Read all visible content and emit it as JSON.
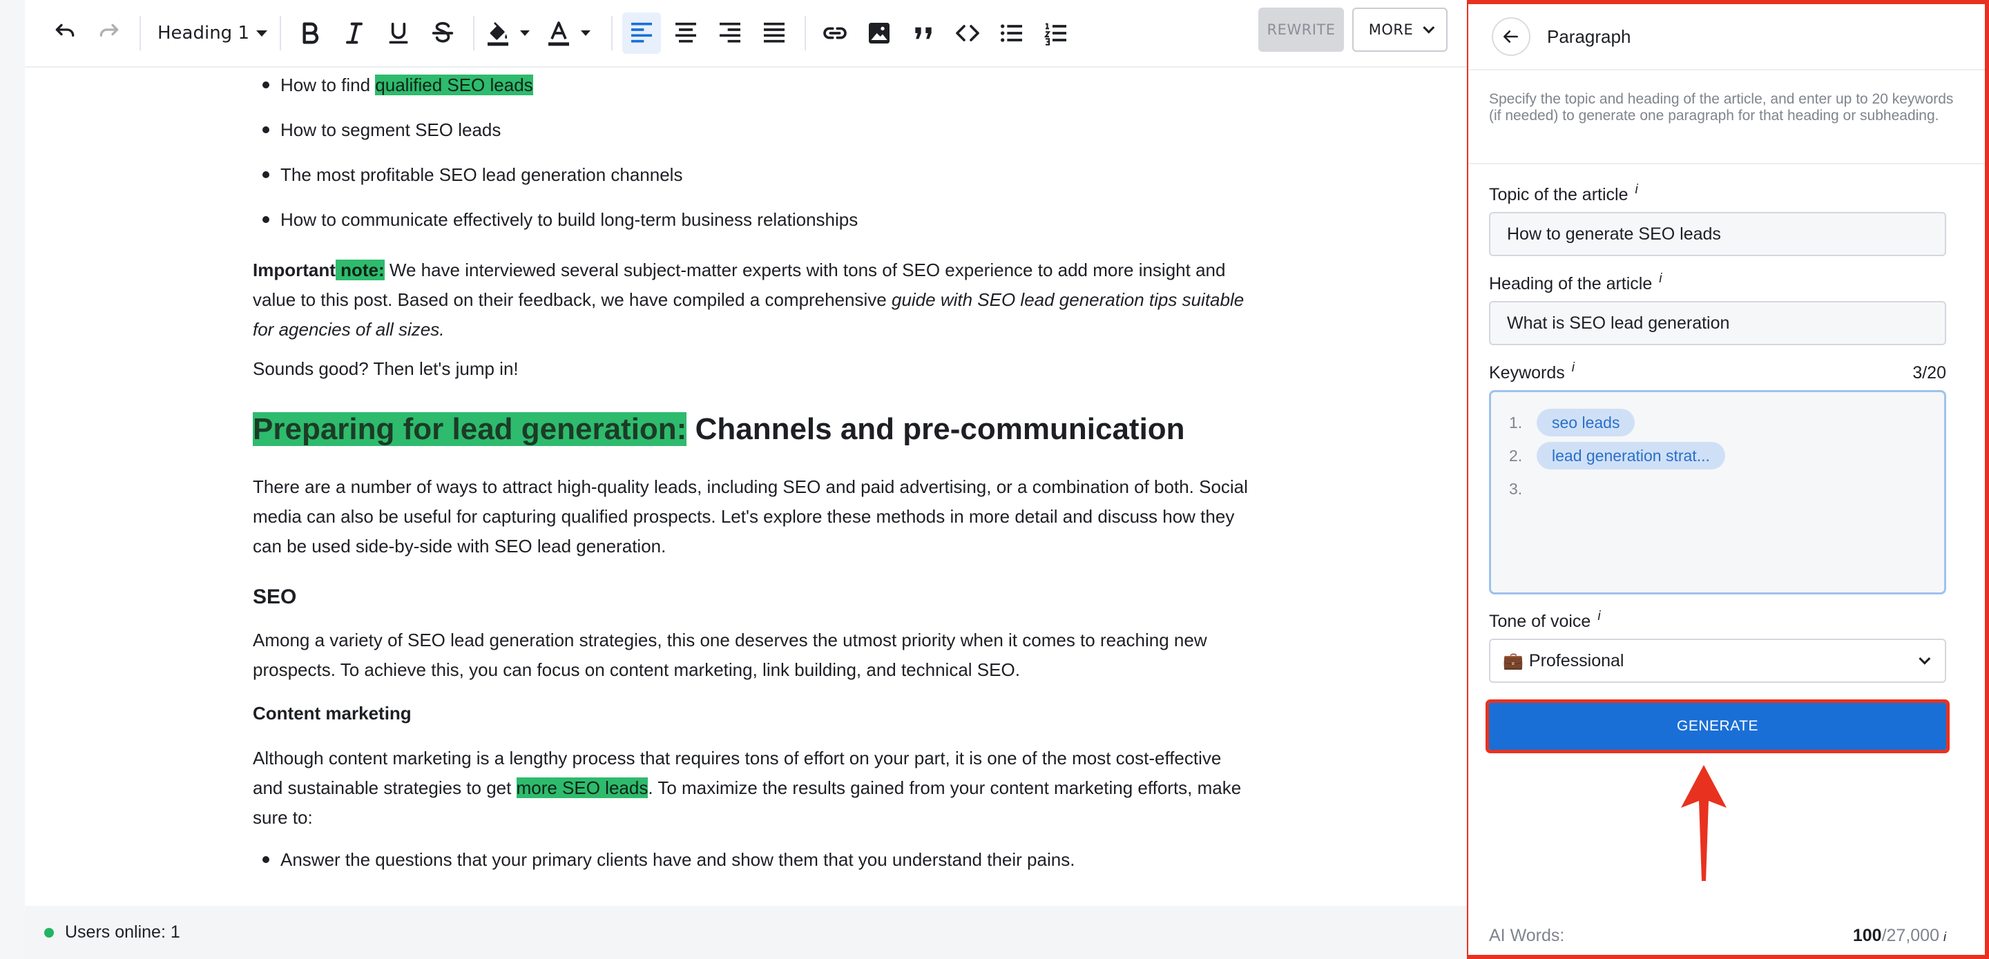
{
  "toolbar": {
    "heading_select": "Heading 1",
    "rewrite_label": "REWRITE",
    "more_label": "MORE"
  },
  "content": {
    "bullets_top": [
      {
        "pre": "How to find ",
        "hl": "qualified SEO leads",
        "post": ""
      },
      {
        "pre": "How to segment SEO leads",
        "hl": "",
        "post": ""
      },
      {
        "pre": "The most profitable SEO lead generation channels",
        "hl": "",
        "post": ""
      },
      {
        "pre": "How to communicate effectively to build long-term business relationships",
        "hl": "",
        "post": ""
      }
    ],
    "note": {
      "bold": "Important",
      "bold_hl": " note:",
      "text1": " We have interviewed several subject-matter experts with tons of SEO experience to add more insight and value to this post. Based on their feedback, we have compiled a comprehensive ",
      "italic": "guide with SEO lead generation tips suitable for agencies of all sizes."
    },
    "sounds_good": "Sounds good? Then let's jump in!",
    "h1_hl": "Preparing for lead generation:",
    "h1_rest": " Channels and pre-communication",
    "para_ways": "There are a number of ways to attract high-quality leads, including SEO and paid advertising, or a combination of both. Social media can also be useful for capturing qualified prospects. Let's explore these methods in more detail and discuss how they can be used side-by-side with SEO lead generation.",
    "h2_seo": "SEO",
    "para_seo": "Among a variety of SEO lead generation strategies, this one deserves the utmost priority when it comes to reaching new prospects. To achieve this, you can focus on content marketing, link building, and technical SEO.",
    "h3_content": "Content marketing",
    "para_cm_pre": "Although content marketing is a lengthy process that requires tons of effort on your part, it is one of the most cost-effective and sustainable strategies to get ",
    "para_cm_hl": "more SEO leads",
    "para_cm_post": ". To maximize the results gained from your content marketing efforts, make sure to:",
    "bullet_bottom": "Answer the questions that your primary clients have and show them that you understand their pains."
  },
  "status": {
    "users_online": "Users online: 1"
  },
  "panel": {
    "title": "Paragraph",
    "description": "Specify the topic and heading of the article, and enter up to 20 keywords (if needed) to generate one paragraph for that heading or subheading.",
    "topic_label": "Topic of the article",
    "topic_value": "How to generate SEO leads",
    "heading_label": "Heading of the article",
    "heading_value": "What is SEO lead generation",
    "keywords_label": "Keywords",
    "keywords_counter": "3/20",
    "keywords": [
      {
        "num": "1.",
        "text": "seo leads"
      },
      {
        "num": "2.",
        "text": "lead generation strat..."
      },
      {
        "num": "3.",
        "text": ""
      }
    ],
    "tone_label": "Tone of voice",
    "tone_emoji": "💼",
    "tone_value": "Professional",
    "info_mark": "i",
    "generate_label": "GENERATE",
    "ai_words_label": "AI Words:",
    "ai_words_used": "100",
    "ai_words_total": "/27,000"
  },
  "colors": {
    "highlight": "#2ebb6d",
    "accent": "#1a6fd6",
    "annotation": "#e8321f"
  }
}
